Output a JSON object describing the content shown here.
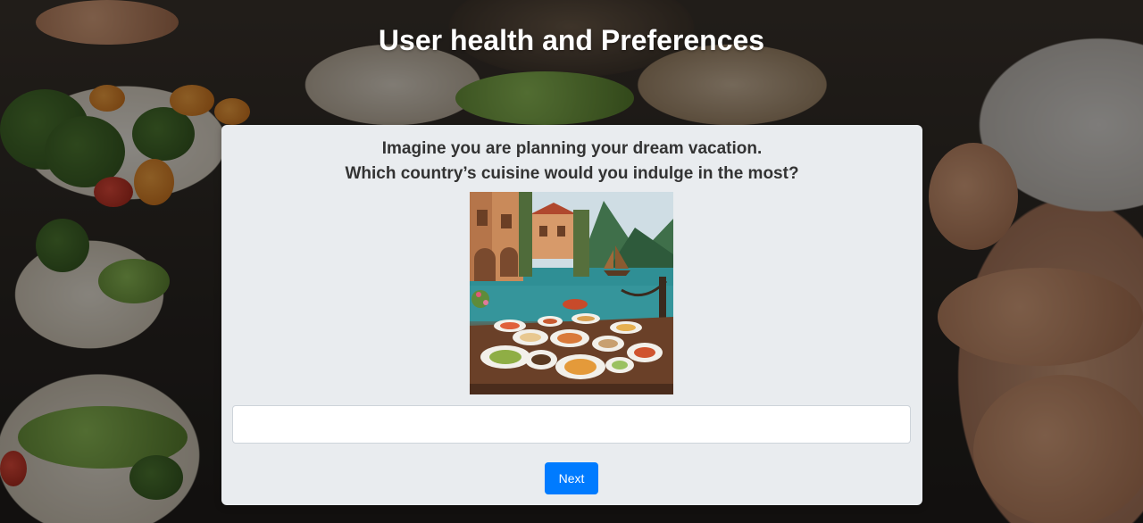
{
  "page": {
    "title": "User health and Preferences"
  },
  "question": {
    "line1": "Imagine you are planning your dream vacation.",
    "line2": "Which country’s cuisine would you indulge in the most?"
  },
  "answer": {
    "value": "",
    "placeholder": ""
  },
  "actions": {
    "next_label": "Next"
  },
  "colors": {
    "primary_button": "#007bff",
    "card_background": "#e9ecef",
    "title_text": "#ffffff",
    "question_text": "#333333"
  },
  "icons": {
    "background": "food-photo",
    "question_image": "lakeside-dinner-image"
  }
}
